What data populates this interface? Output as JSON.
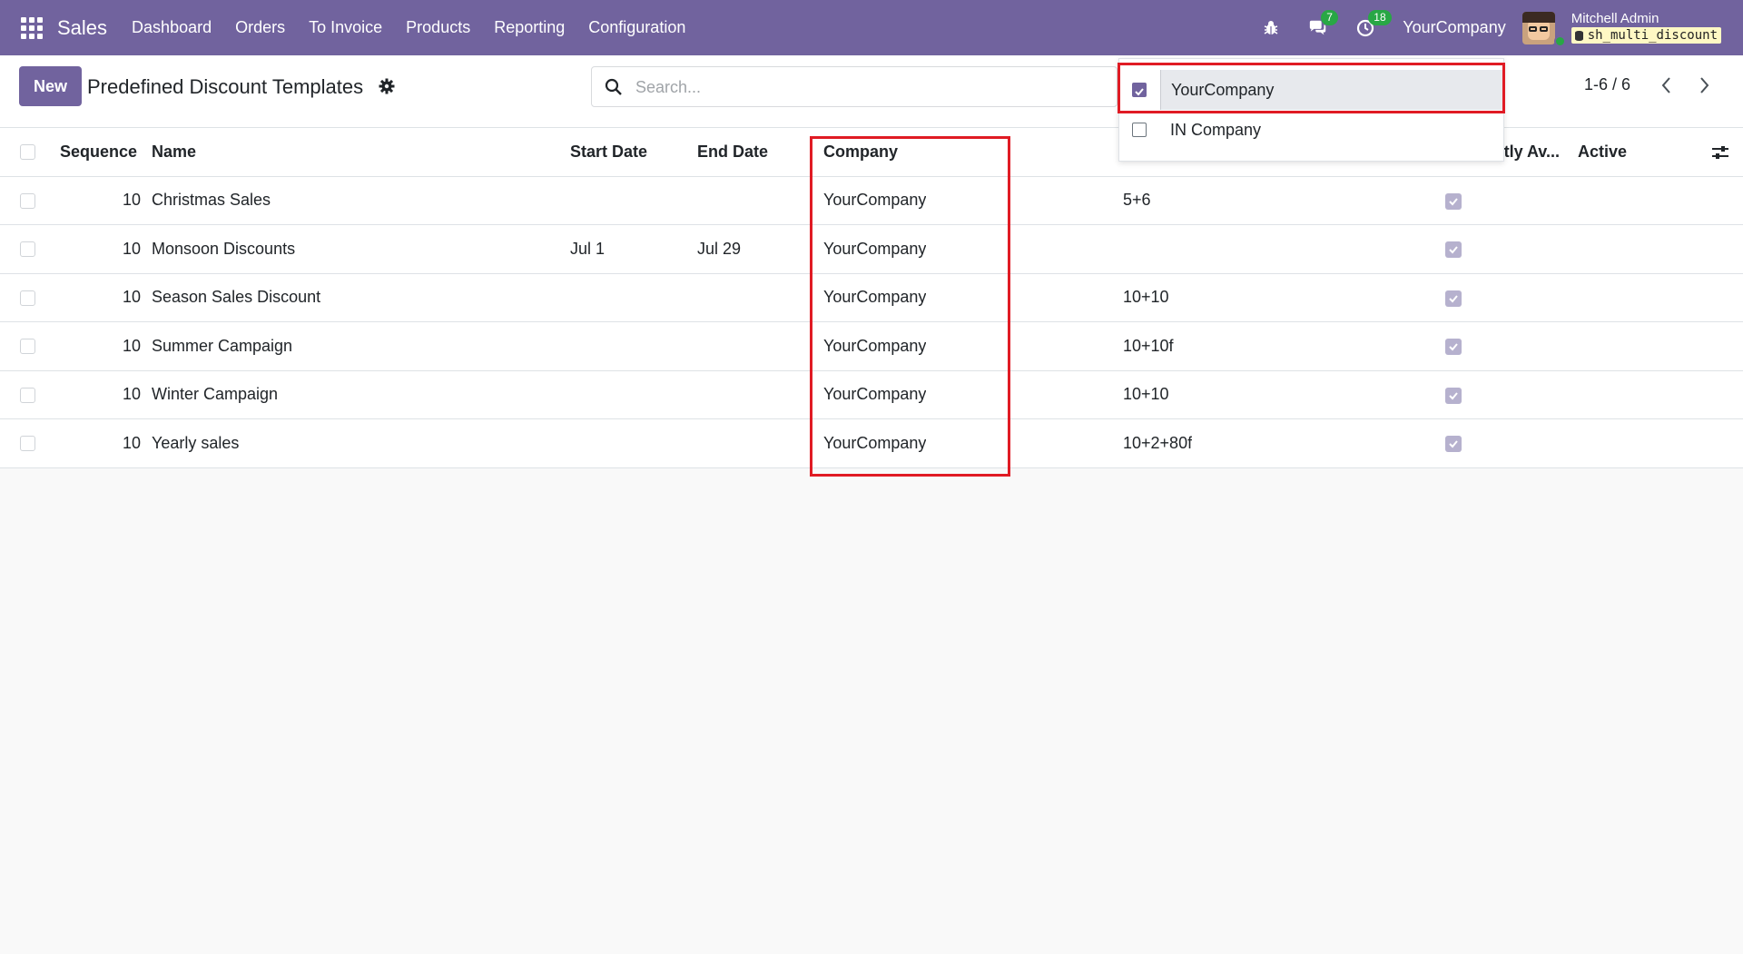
{
  "navbar": {
    "app_name": "Sales",
    "menu": [
      "Dashboard",
      "Orders",
      "To Invoice",
      "Products",
      "Reporting",
      "Configuration"
    ],
    "messages_count": "7",
    "activities_count": "18",
    "current_company": "YourCompany",
    "user_name": "Mitchell Admin",
    "database": "sh_multi_discount"
  },
  "control": {
    "new_label": "New",
    "title": "Predefined Discount Templates",
    "search_placeholder": "Search...",
    "pager": "1-6 / 6"
  },
  "table": {
    "headers": {
      "sequence": "Sequence",
      "name": "Name",
      "start_date": "Start Date",
      "end_date": "End Date",
      "company": "Company",
      "availability": "tly Av...",
      "active": "Active"
    },
    "rows": [
      {
        "sequence": "10",
        "name": "Christmas Sales",
        "start": "",
        "end": "",
        "company": "YourCompany",
        "discount": "5+6",
        "active": true
      },
      {
        "sequence": "10",
        "name": "Monsoon Discounts",
        "start": "Jul 1",
        "end": "Jul 29",
        "company": "YourCompany",
        "discount": "",
        "active": true
      },
      {
        "sequence": "10",
        "name": "Season Sales Discount",
        "start": "",
        "end": "",
        "company": "YourCompany",
        "discount": "10+10",
        "active": true
      },
      {
        "sequence": "10",
        "name": "Summer Campaign",
        "start": "",
        "end": "",
        "company": "YourCompany",
        "discount": "10+10f",
        "active": true
      },
      {
        "sequence": "10",
        "name": "Winter Campaign",
        "start": "",
        "end": "",
        "company": "YourCompany",
        "discount": "10+10",
        "active": true
      },
      {
        "sequence": "10",
        "name": "Yearly sales",
        "start": "",
        "end": "",
        "company": "YourCompany",
        "discount": "10+2+80f",
        "active": true
      }
    ]
  },
  "company_dropdown": {
    "items": [
      {
        "label": "YourCompany",
        "checked": true
      },
      {
        "label": "IN Company",
        "checked": false
      }
    ]
  },
  "colors": {
    "brand": "#71639e",
    "badge": "#28a745",
    "highlight": "#e01b24"
  }
}
